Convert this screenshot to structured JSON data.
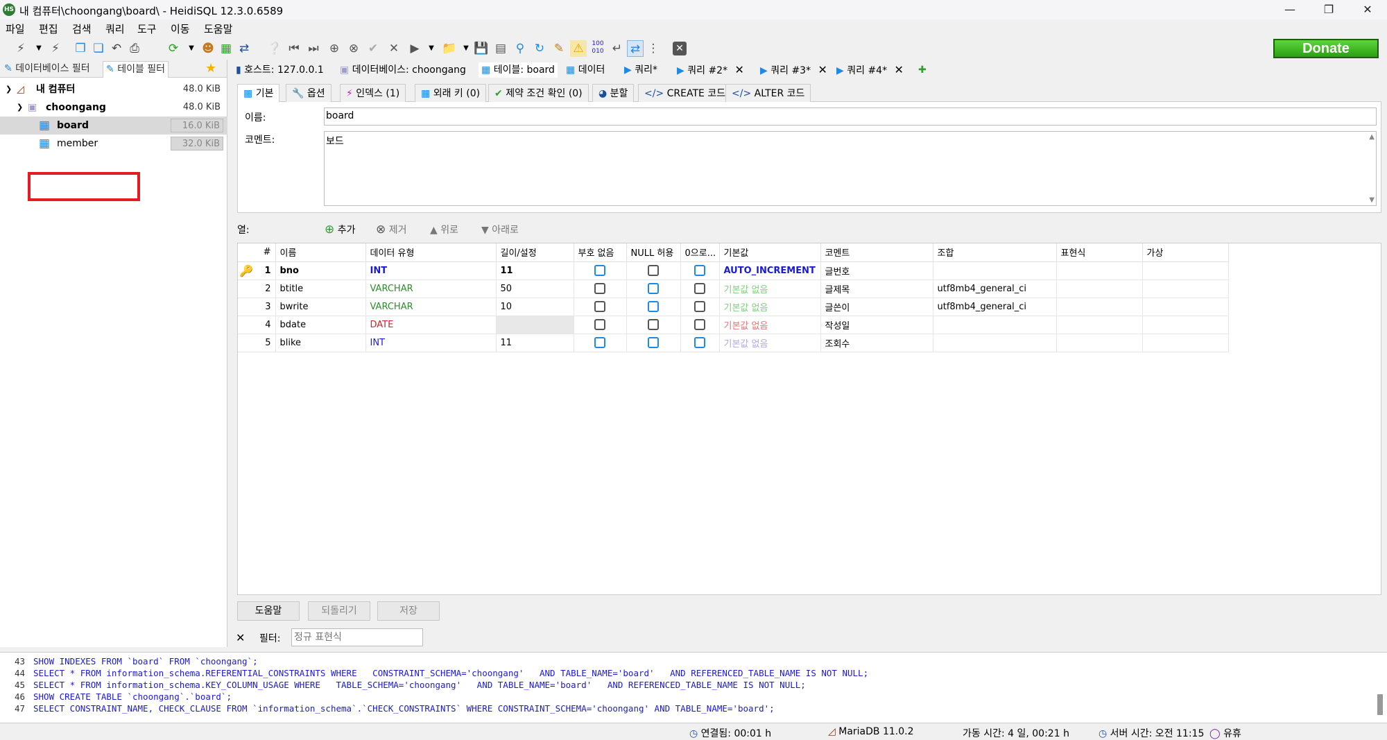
{
  "window": {
    "title": "내 컴퓨터\\choongang\\board\\ - HeidiSQL 12.3.0.6589",
    "app_icon_text": "HS"
  },
  "menu": [
    "파일",
    "편집",
    "검색",
    "쿼리",
    "도구",
    "이동",
    "도움말"
  ],
  "donate_label": "Donate",
  "left_pane": {
    "filter_tabs": [
      "데이터베이스 필터",
      "테이블 필터"
    ],
    "tree": [
      {
        "label": "내 컴퓨터",
        "size": "48.0 KiB",
        "level": 0
      },
      {
        "label": "choongang",
        "size": "48.0 KiB",
        "level": 1
      },
      {
        "label": "board",
        "size": "16.0 KiB",
        "level": 2,
        "selected": true
      },
      {
        "label": "member",
        "size": "32.0 KiB",
        "level": 2
      }
    ]
  },
  "main_tabs": [
    {
      "label": "호스트: 127.0.0.1"
    },
    {
      "label": "데이터베이스: choongang"
    },
    {
      "label": "테이블: board"
    },
    {
      "label": "데이터"
    },
    {
      "label": "쿼리*"
    },
    {
      "label": "쿼리 #2*"
    },
    {
      "label": "쿼리 #3*"
    },
    {
      "label": "쿼리 #4*"
    }
  ],
  "sub_tabs": [
    "기본",
    "옵션",
    "인덱스 (1)",
    "외래 키 (0)",
    "제약 조건 확인 (0)",
    "분할",
    "CREATE 코드",
    "ALTER 코드"
  ],
  "form": {
    "name_label": "이름:",
    "name_value": "board",
    "comment_label": "코멘트:",
    "comment_value": "보드"
  },
  "columns_toolbar": {
    "label": "열:",
    "add": "추가",
    "remove": "제거",
    "up": "위로",
    "down": "아래로"
  },
  "grid": {
    "headers": [
      "#",
      "이름",
      "데이터 유형",
      "길이/설정",
      "부호 없음",
      "NULL 허용",
      "0으로...",
      "기본값",
      "코멘트",
      "조합",
      "표현식",
      "가상"
    ],
    "rows": [
      {
        "num": "1",
        "name": "bno",
        "type": "INT",
        "length": "11",
        "default": "AUTO_INCREMENT",
        "comment": "글번호",
        "collation": "",
        "key": true,
        "type_color": "#1a1ad6",
        "default_color": "#1a1ad6",
        "null_allowed": false
      },
      {
        "num": "2",
        "name": "btitle",
        "type": "VARCHAR",
        "length": "50",
        "default": "기본값 없음",
        "comment": "글제목",
        "collation": "utf8mb4_general_ci",
        "type_color": "#2e8b2e",
        "default_color": "#7bcf7b"
      },
      {
        "num": "3",
        "name": "bwrite",
        "type": "VARCHAR",
        "length": "10",
        "default": "기본값 없음",
        "comment": "글쓴이",
        "collation": "utf8mb4_general_ci",
        "type_color": "#2e8b2e",
        "default_color": "#7bcf7b"
      },
      {
        "num": "4",
        "name": "bdate",
        "type": "DATE",
        "length": "",
        "default": "기본값 없음",
        "comment": "작성일",
        "collation": "",
        "type_color": "#c62828",
        "default_color": "#e57373"
      },
      {
        "num": "5",
        "name": "blike",
        "type": "INT",
        "length": "11",
        "default": "기본값 없음",
        "comment": "조회수",
        "collation": "",
        "type_color": "#1a1ad6",
        "default_color": "#a9a9e8"
      }
    ]
  },
  "bottom_buttons": [
    "도움말",
    "되돌리기",
    "저장"
  ],
  "filter": {
    "label": "필터:",
    "placeholder": "정규 표현식"
  },
  "sql_log": [
    {
      "n": "43",
      "code": "SHOW INDEXES FROM `board` FROM `choongang`;"
    },
    {
      "n": "44",
      "code": "SELECT * FROM information_schema.REFERENTIAL_CONSTRAINTS WHERE   CONSTRAINT_SCHEMA='choongang'   AND TABLE_NAME='board'   AND REFERENCED_TABLE_NAME IS NOT NULL;"
    },
    {
      "n": "45",
      "code": "SELECT * FROM information_schema.KEY_COLUMN_USAGE WHERE   TABLE_SCHEMA='choongang'   AND TABLE_NAME='board'   AND REFERENCED_TABLE_NAME IS NOT NULL;"
    },
    {
      "n": "46",
      "code": "SHOW CREATE TABLE `choongang`.`board`;"
    },
    {
      "n": "47",
      "code": "SELECT CONSTRAINT_NAME, CHECK_CLAUSE FROM `information_schema`.`CHECK_CONSTRAINTS` WHERE CONSTRAINT_SCHEMA='choongang' AND TABLE_NAME='board';"
    }
  ],
  "status": {
    "connected": "연결됨: 00:01 h",
    "server": "MariaDB 11.0.2",
    "uptime": "가동 시간: 4 일, 00:21 h",
    "server_time": "서버 시간: 오전 11:15",
    "idle": "유휴"
  },
  "colors": {
    "accent": "#1e88e5",
    "highlight": "#e31b23",
    "donate": "#3fbf1f"
  }
}
